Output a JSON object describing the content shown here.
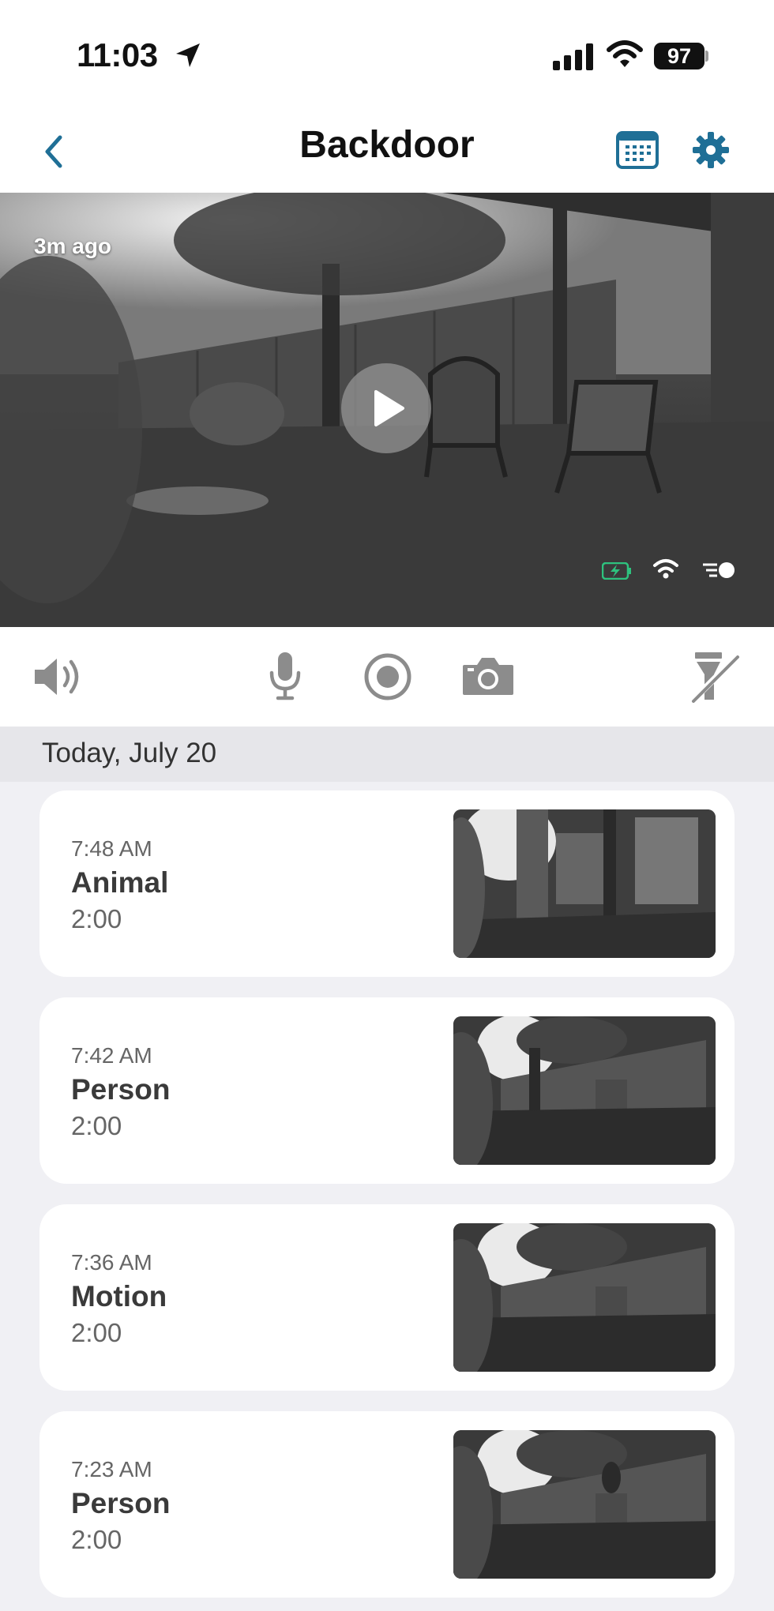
{
  "status_bar": {
    "time": "11:03",
    "battery_level": "97"
  },
  "nav": {
    "title": "Backdoor"
  },
  "live_view": {
    "last_update": "3m ago"
  },
  "history": {
    "section_title": "Today, July 20",
    "events": [
      {
        "time": "7:48 AM",
        "type": "Animal",
        "duration": "2:00"
      },
      {
        "time": "7:42 AM",
        "type": "Person",
        "duration": "2:00"
      },
      {
        "time": "7:36 AM",
        "type": "Motion",
        "duration": "2:00"
      },
      {
        "time": "7:23 AM",
        "type": "Person",
        "duration": "2:00"
      }
    ]
  },
  "colors": {
    "accent": "#1f6f96",
    "battery_green": "#2ec27e",
    "icon_gray": "#8c8c8c"
  },
  "icons": [
    "location-arrow-icon",
    "cellular-signal-icon",
    "wifi-icon",
    "back-chevron-icon",
    "calendar-icon",
    "gear-icon",
    "play-icon",
    "camera-battery-charging-icon",
    "camera-wifi-icon",
    "spotlight-toggle-icon",
    "speaker-icon",
    "microphone-icon",
    "record-icon",
    "snapshot-camera-icon",
    "flashlight-off-icon"
  ]
}
